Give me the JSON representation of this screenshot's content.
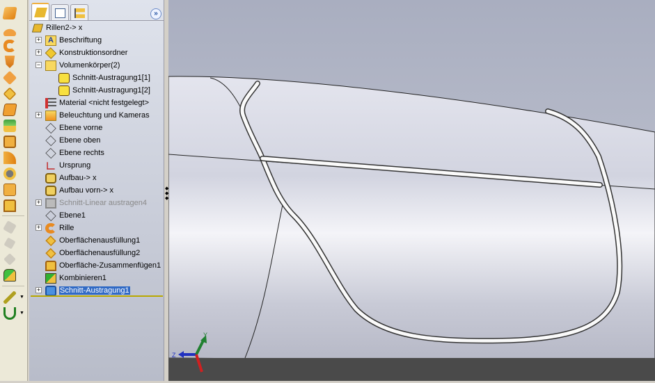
{
  "tree": {
    "root": "Rillen2-> x",
    "items": [
      {
        "label": "Beschriftung",
        "icon": "annotation-icon",
        "expand": "+",
        "level": 1
      },
      {
        "label": "Konstruktionsordner",
        "icon": "design-folder-icon",
        "expand": "+",
        "level": 1
      },
      {
        "label": "Volumenkörper(2)",
        "icon": "solid-bodies-folder-icon",
        "expand": "−",
        "level": 1
      },
      {
        "label": "Schnitt-Austragung1[1]",
        "icon": "solid-body-icon",
        "expand": "",
        "level": 2
      },
      {
        "label": "Schnitt-Austragung1[2]",
        "icon": "solid-body-icon",
        "expand": "",
        "level": 2
      },
      {
        "label": "Material <nicht festgelegt>",
        "icon": "material-icon",
        "expand": "",
        "level": 1
      },
      {
        "label": "Beleuchtung und Kameras",
        "icon": "lights-folder-icon",
        "expand": "+",
        "level": 1
      },
      {
        "label": "Ebene vorne",
        "icon": "plane-icon",
        "expand": "",
        "level": 1
      },
      {
        "label": "Ebene oben",
        "icon": "plane-icon",
        "expand": "",
        "level": 1
      },
      {
        "label": "Ebene rechts",
        "icon": "plane-icon",
        "expand": "",
        "level": 1
      },
      {
        "label": "Ursprung",
        "icon": "origin-icon",
        "expand": "",
        "level": 1
      },
      {
        "label": "Aufbau-> x",
        "icon": "sketch3d-icon",
        "expand": "",
        "level": 1
      },
      {
        "label": "Aufbau vorn-> x",
        "icon": "sketch3d-icon",
        "expand": "",
        "level": 1
      },
      {
        "label": "Schnitt-Linear austragen4",
        "icon": "suppressed-cut-icon",
        "expand": "+",
        "level": 1,
        "suppressed": true
      },
      {
        "label": "Ebene1",
        "icon": "plane-icon",
        "expand": "",
        "level": 1
      },
      {
        "label": "Rille",
        "icon": "swept-surface-icon",
        "expand": "+",
        "level": 1
      },
      {
        "label": "Oberflächenausfüllung1",
        "icon": "filled-surface-icon",
        "expand": "",
        "level": 1
      },
      {
        "label": "Oberflächenausfüllung2",
        "icon": "filled-surface-icon",
        "expand": "",
        "level": 1
      },
      {
        "label": "Oberfläche-Zusammenfügen1",
        "icon": "knit-surface-icon",
        "expand": "",
        "level": 1
      },
      {
        "label": "Kombinieren1",
        "icon": "combine-icon",
        "expand": "",
        "level": 1
      },
      {
        "label": "Schnitt-Austragung1",
        "icon": "swept-cut-icon",
        "expand": "+",
        "level": 1,
        "selected": true
      }
    ]
  },
  "triad": {
    "z": "Z",
    "y": "Y"
  },
  "colors": {
    "selection": "#316ac5",
    "viewport_bg": "#b8bccb",
    "floor": "#4a4a4a"
  }
}
